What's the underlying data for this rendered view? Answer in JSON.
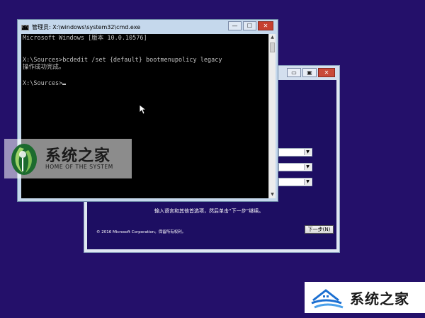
{
  "setup_window": {
    "controls": {
      "minimize": "▭",
      "restore": "▣",
      "close": "✕"
    },
    "hint": "输入语言和其他首选项，然后单击“下一步”继续。",
    "copyright": "© 2016 Microsoft Corporation。保留所有权利。",
    "next_button": "下一步(N)",
    "combo_arrow": "▼"
  },
  "cmd_window": {
    "title": "管理员: X:\\windows\\system32\\cmd.exe",
    "icon_text": "C:\\",
    "controls": {
      "minimize": "—",
      "maximize": "☐",
      "close": "✕"
    },
    "lines": [
      "Microsoft Windows [版本 10.0.10576]",
      "",
      "X:\\Sources>bcdedit /set {default} bootmenupolicy legacy",
      "操作成功完成。",
      "",
      "X:\\Sources>"
    ]
  },
  "watermark_top": {
    "cn": "系统之家",
    "en": "HOME OF THE SYSTEM"
  },
  "watermark_bottom": {
    "cn": "系统之家"
  },
  "colors": {
    "desktop": "#24106a",
    "console_bg": "#000000",
    "console_fg": "#c0c0c0",
    "close_red": "#c6402f"
  }
}
